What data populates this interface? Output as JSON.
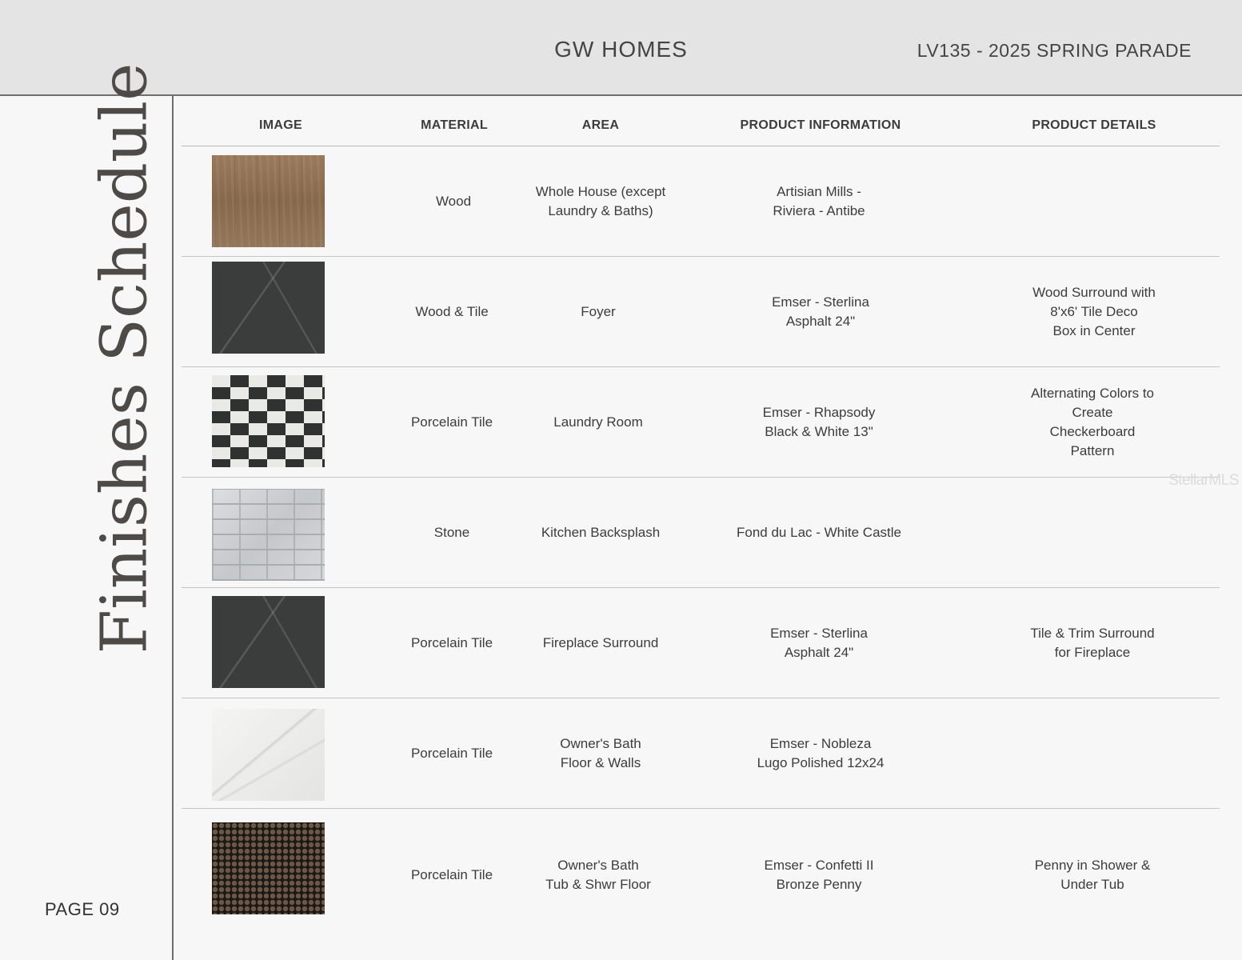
{
  "header": {
    "brand": "GW HOMES",
    "project": "LV135 - 2025 SPRING PARADE"
  },
  "sidebar": {
    "title": "Finishes Schedule",
    "page": "PAGE 09"
  },
  "table": {
    "columns": [
      "IMAGE",
      "MATERIAL",
      "AREA",
      "PRODUCT INFORMATION",
      "PRODUCT DETAILS"
    ],
    "rows": [
      {
        "swatch": "wood-plank-swatch",
        "material": "Wood",
        "area": "Whole House (except\nLaundry & Baths)",
        "product_info": "Artisian Mills -\nRiviera - Antibe",
        "details": ""
      },
      {
        "swatch": "dark-tile-swatch",
        "material": "Wood & Tile",
        "area": "Foyer",
        "product_info": "Emser - Sterlina\nAsphalt 24\"",
        "details": "Wood Surround with 8'x6' Tile Deco\nBox in Center"
      },
      {
        "swatch": "checkerboard-tile-swatch",
        "material": "Porcelain Tile",
        "area": "Laundry Room",
        "product_info": "Emser - Rhapsody\nBlack & White 13\"",
        "details": "Alternating Colors to Create\nCheckerboard Pattern"
      },
      {
        "swatch": "stone-swatch",
        "material": "Stone",
        "area": "Kitchen Backsplash",
        "product_info": "Fond du Lac - White Castle",
        "details": ""
      },
      {
        "swatch": "dark-tile-swatch",
        "material": "Porcelain Tile",
        "area": "Fireplace Surround",
        "product_info": "Emser - Sterlina\nAsphalt 24\"",
        "details": "Tile & Trim Surround for Fireplace"
      },
      {
        "swatch": "white-marble-swatch",
        "material": "Porcelain Tile",
        "area": "Owner's Bath\nFloor & Walls",
        "product_info": "Emser - Nobleza\nLugo Polished 12x24",
        "details": ""
      },
      {
        "swatch": "penny-tile-swatch",
        "material": "Porcelain Tile",
        "area": "Owner's Bath\nTub & Shwr Floor",
        "product_info": "Emser - Confetti II\nBronze Penny",
        "details": "Penny in Shower & Under Tub"
      }
    ]
  },
  "watermark": "StellarMLS"
}
